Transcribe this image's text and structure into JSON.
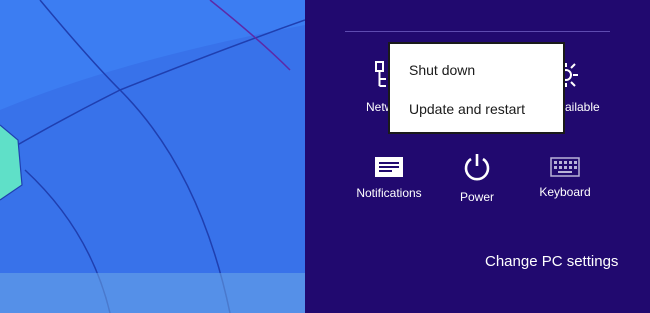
{
  "charms": {
    "tiles": [
      {
        "label": "Netw",
        "icon": "network-icon"
      },
      {
        "label": "ailable",
        "icon": "brightness-icon"
      },
      {
        "label": "Notifications",
        "icon": "notifications-icon"
      },
      {
        "label": "Power",
        "icon": "power-icon"
      },
      {
        "label": "Keyboard",
        "icon": "keyboard-icon"
      }
    ],
    "change_pc_settings": "Change PC settings"
  },
  "power_menu": {
    "items": [
      "Shut down",
      "Update and restart"
    ]
  },
  "colors": {
    "charms_bg": "#21096f",
    "wallpaper_blue": "#3a78f0",
    "menu_bg": "#ffffff"
  }
}
